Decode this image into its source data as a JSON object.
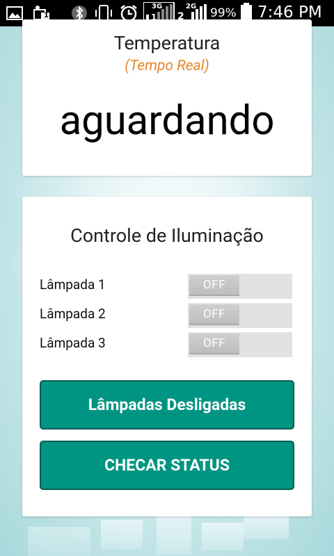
{
  "status_bar": {
    "time": "7:46 PM",
    "battery_percent": "99%",
    "network_3g": "3G",
    "network_2g": "2G",
    "sim1": "1",
    "sim2": "2",
    "icons": [
      "gallery-icon",
      "sim-notification-icon",
      "bluetooth-icon",
      "vibrate-icon",
      "alarm-icon",
      "signal-3g-icon",
      "signal-2g-icon",
      "battery-icon"
    ]
  },
  "temperature": {
    "title": "Temperatura",
    "subtitle": "(Tempo Real)",
    "value": "aguardando",
    "subtitle_color": "#e5862a"
  },
  "lighting": {
    "title": "Controle de Iluminação",
    "lamps": [
      {
        "label": "Lâmpada 1",
        "state": "OFF"
      },
      {
        "label": "Lâmpada 2",
        "state": "OFF"
      },
      {
        "label": "Lâmpada 3",
        "state": "OFF"
      }
    ],
    "primary_button": "Lâmpadas Desligadas",
    "status_button": "CHECAR STATUS",
    "accent_color": "#009482"
  }
}
